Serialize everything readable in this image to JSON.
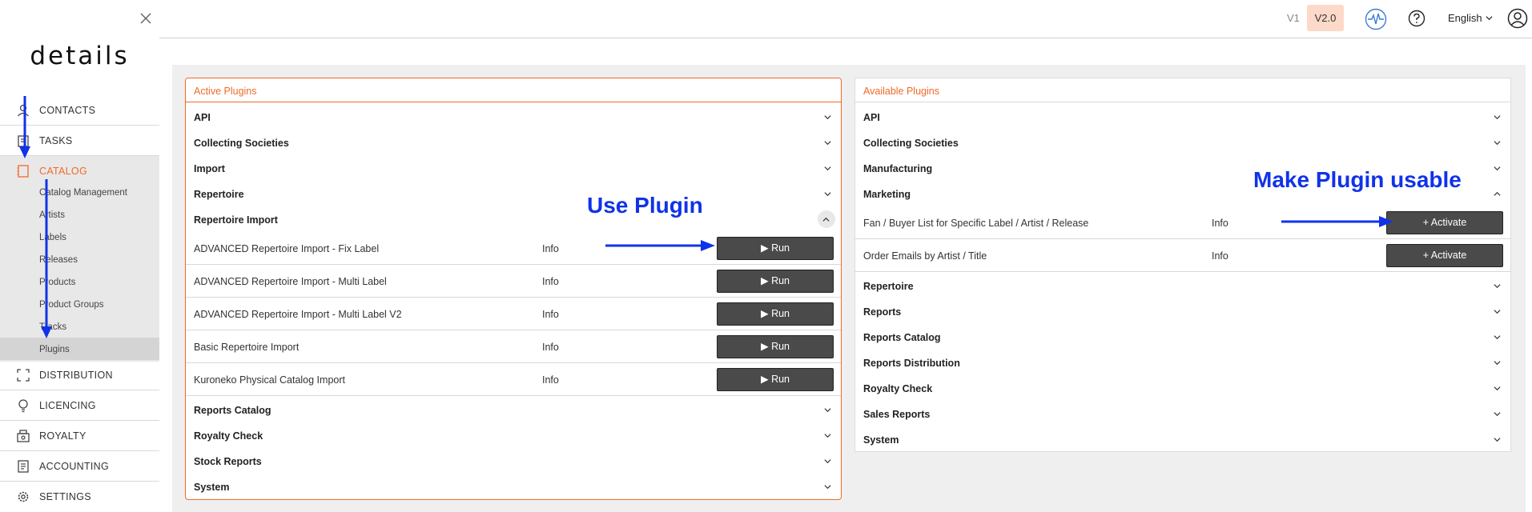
{
  "sidebar": {
    "logo": "details",
    "nav_top": [
      {
        "label": "CONTACTS",
        "icon": "person-icon"
      },
      {
        "label": "TASKS",
        "icon": "clipboard-icon"
      },
      {
        "label": "CATALOG",
        "icon": "catalog-icon",
        "active": true
      }
    ],
    "catalog_sub": [
      {
        "label": "Catalog Management"
      },
      {
        "label": "Artists"
      },
      {
        "label": "Labels"
      },
      {
        "label": "Releases"
      },
      {
        "label": "Products"
      },
      {
        "label": "Product Groups"
      },
      {
        "label": "Tracks"
      },
      {
        "label": "Plugins",
        "selected": true
      }
    ],
    "nav_bottom": [
      {
        "label": "DISTRIBUTION",
        "icon": "expand-icon"
      },
      {
        "label": "LICENCING",
        "icon": "lightbulb-icon"
      },
      {
        "label": "ROYALTY",
        "icon": "register-icon"
      },
      {
        "label": "ACCOUNTING",
        "icon": "document-icon"
      },
      {
        "label": "SETTINGS",
        "icon": "gear-icon"
      }
    ]
  },
  "topbar": {
    "v1_label": "V1",
    "v2_label": "V2.0",
    "language": "English"
  },
  "active_plugins": {
    "title": "Active Plugins",
    "categories_top": [
      "API",
      "Collecting Societies",
      "Import",
      "Repertoire"
    ],
    "expanded_category": "Repertoire Import",
    "plugins": [
      {
        "name": "ADVANCED Repertoire Import - Fix Label",
        "info": "Info",
        "action": "Run"
      },
      {
        "name": "ADVANCED Repertoire Import - Multi Label",
        "info": "Info",
        "action": "Run"
      },
      {
        "name": "ADVANCED Repertoire Import - Multi Label V2",
        "info": "Info",
        "action": "Run"
      },
      {
        "name": "Basic Repertoire Import",
        "info": "Info",
        "action": "Run"
      },
      {
        "name": "Kuroneko Physical Catalog Import",
        "info": "Info",
        "action": "Run"
      }
    ],
    "categories_bottom": [
      "Reports Catalog",
      "Royalty Check",
      "Stock Reports",
      "System"
    ]
  },
  "available_plugins": {
    "title": "Available Plugins",
    "categories_top": [
      "API",
      "Collecting Societies",
      "Manufacturing"
    ],
    "expanded_category": "Marketing",
    "plugins": [
      {
        "name": "Fan / Buyer List for Specific Label / Artist / Release",
        "info": "Info",
        "action": "+ Activate"
      },
      {
        "name": "Order Emails by Artist / Title",
        "info": "Info",
        "action": "+ Activate"
      }
    ],
    "categories_bottom": [
      "Repertoire",
      "Reports",
      "Reports Catalog",
      "Reports Distribution",
      "Royalty Check",
      "Sales Reports",
      "System"
    ]
  },
  "annotations": {
    "use_plugin": "Use Plugin",
    "make_usable": "Make Plugin usable"
  },
  "colors": {
    "accent": "#f06a28",
    "annotation": "#1033e8",
    "button": "#4a4a4a",
    "version_badge": "#fcd9c8"
  }
}
